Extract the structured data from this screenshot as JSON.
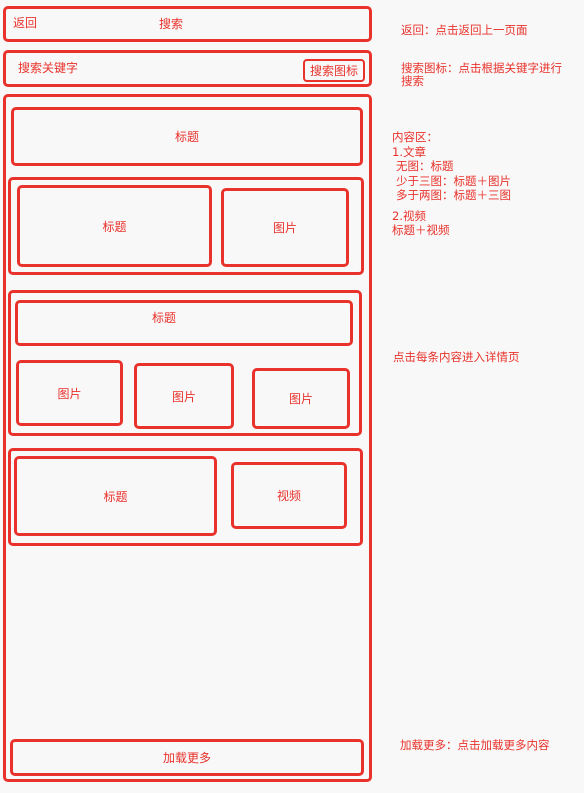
{
  "header": {
    "back_label": "返回",
    "title": "搜索"
  },
  "search": {
    "placeholder": "搜索关键字",
    "icon_label": "搜索图标"
  },
  "content": {
    "block1": {
      "title": "标题"
    },
    "block2": {
      "title": "标题",
      "image": "图片"
    },
    "block3": {
      "title": "标题",
      "images": [
        "图片",
        "图片",
        "图片"
      ]
    },
    "block4": {
      "title": "标题",
      "video": "视频"
    },
    "load_more": "加载更多"
  },
  "notes": {
    "back": "返回：点击返回上一页面",
    "search_icon_line1": "搜索图标：点击根据关键字进行",
    "search_icon_line2": "搜索",
    "content_lines": [
      "内容区：",
      "1.文章",
      "无图：标题",
      "少于三图：标题＋图片",
      "多于两图：标题＋三图"
    ],
    "video_lines": [
      "2.视频",
      "标题＋视频"
    ],
    "detail": "点击每条内容进入详情页",
    "load_more": "加载更多：点击加载更多内容"
  },
  "colors": {
    "accent": "#e8322b",
    "background": "#f8f8f8"
  }
}
